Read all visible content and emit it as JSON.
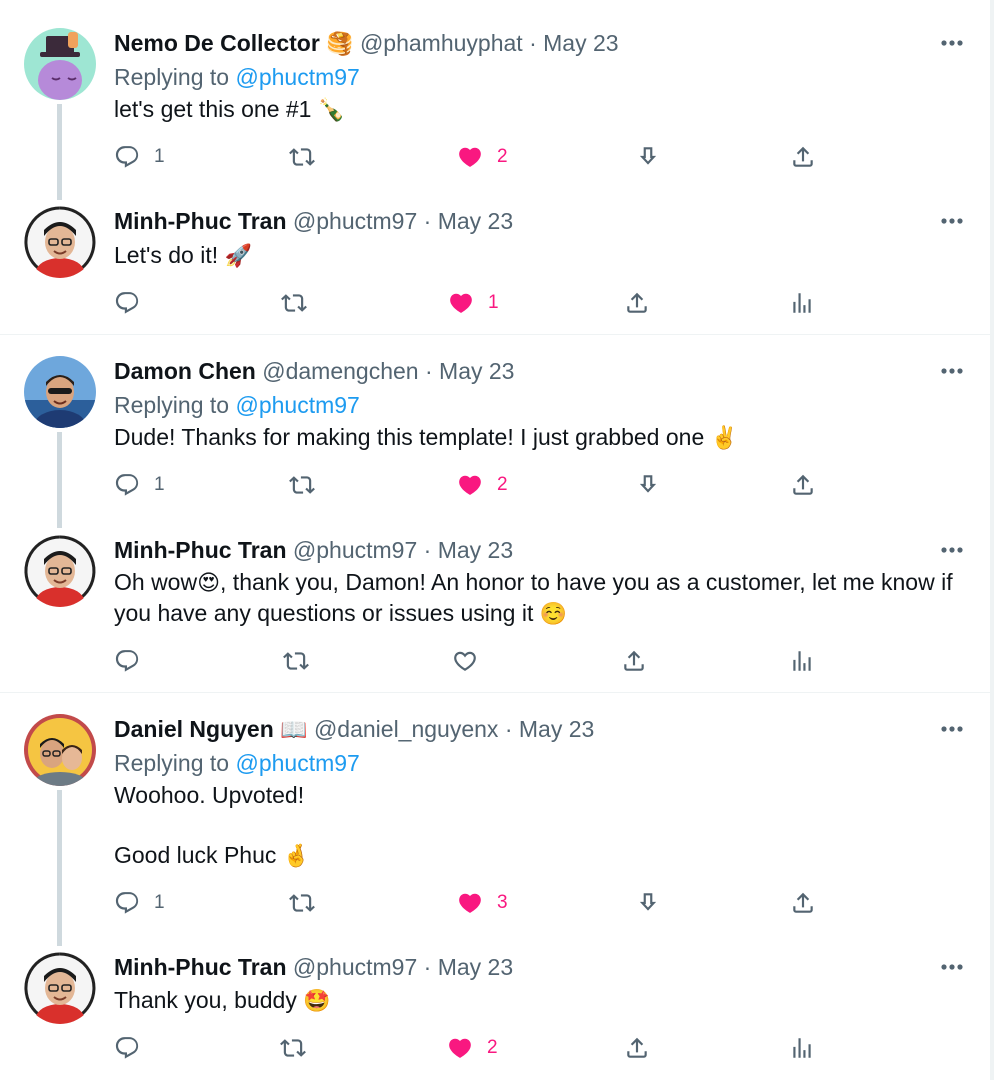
{
  "replying_label": "Replying to",
  "tweets": [
    {
      "name": "Nemo De Collector",
      "name_emoji": "🥞",
      "handle": "@phamhuyphat",
      "date": "May 23",
      "reply_to": "@phuctm97",
      "text": "let's get this one #1",
      "text_emoji": "🍾",
      "reply_count": "1",
      "like_count": "2",
      "liked": true
    },
    {
      "name": "Minh-Phuc Tran",
      "handle": "@phuctm97",
      "date": "May 23",
      "text": "Let's do it!",
      "text_emoji": "🚀",
      "like_count": "1",
      "liked": true
    },
    {
      "name": "Damon Chen",
      "handle": "@damengchen",
      "date": "May 23",
      "reply_to": "@phuctm97",
      "text": "Dude! Thanks for making this template! I just grabbed one",
      "text_emoji": "✌️",
      "reply_count": "1",
      "like_count": "2",
      "liked": true
    },
    {
      "name": "Minh-Phuc Tran",
      "handle": "@phuctm97",
      "date": "May 23",
      "text_part1": "Oh wow",
      "text_emoji1": "😍",
      "text_part2": ", thank you, Damon! An honor to have you as a customer, let me know if you have any questions or issues using it",
      "text_emoji2": "☺️",
      "liked": false
    },
    {
      "name": "Daniel Nguyen",
      "name_emoji": "📖",
      "handle": "@daniel_nguyenx",
      "date": "May 23",
      "reply_to": "@phuctm97",
      "text_line1": "Woohoo. Upvoted!",
      "text_line2": "Good luck Phuc",
      "text_emoji": "🤞",
      "reply_count": "1",
      "like_count": "3",
      "liked": true
    },
    {
      "name": "Minh-Phuc Tran",
      "handle": "@phuctm97",
      "date": "May 23",
      "text": "Thank you, buddy",
      "text_emoji": "🤩",
      "like_count": "2",
      "liked": true
    }
  ],
  "icons": {
    "reply": "reply-icon",
    "retweet": "retweet-icon",
    "like": "heart-icon",
    "save": "download-icon",
    "share": "share-icon",
    "analytics": "analytics-icon",
    "more": "more-icon"
  },
  "colors": {
    "like": "#f91880",
    "link": "#1d9bf0",
    "secondary": "#536471",
    "thread_line": "#cfd9de"
  }
}
